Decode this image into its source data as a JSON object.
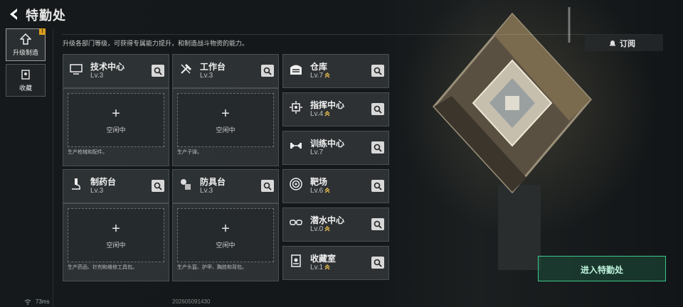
{
  "header": {
    "title": "特勤处",
    "back_label": ""
  },
  "subtitle": "升级各部门等级，可获得专属能力提升，和制造战斗物资的能力。",
  "tabs": [
    {
      "label": "升级制造",
      "badge": "!"
    },
    {
      "label": "收藏"
    }
  ],
  "subscribe_label": "订阅",
  "enter_label": "进入特勤处",
  "large_cards": [
    {
      "name": "技术中心",
      "level": "Lv.3",
      "slot_status": "空闲中",
      "slot_plus": "+",
      "desc": "生产枪械和配件。",
      "icon": "monitor-icon"
    },
    {
      "name": "工作台",
      "level": "Lv.3",
      "slot_status": "空闲中",
      "slot_plus": "+",
      "desc": "生产子弹。",
      "icon": "hammer-icon"
    },
    {
      "name": "制药台",
      "level": "Lv.3",
      "slot_status": "空闲中",
      "slot_plus": "+",
      "desc": "生产药品、针剂和维修工具包。",
      "icon": "microscope-icon"
    },
    {
      "name": "防具台",
      "level": "Lv.3",
      "slot_status": "空闲中",
      "slot_plus": "+",
      "desc": "生产头盔、护甲、胸挂和背包。",
      "icon": "armor-icon"
    }
  ],
  "small_cards": [
    {
      "name": "仓库",
      "level": "Lv.7",
      "upgrade": true,
      "icon": "warehouse-icon"
    },
    {
      "name": "指挥中心",
      "level": "Lv.4",
      "upgrade": true,
      "icon": "chip-icon"
    },
    {
      "name": "训练中心",
      "level": "Lv.7",
      "upgrade": false,
      "icon": "dumbbell-icon"
    },
    {
      "name": "靶场",
      "level": "Lv.6",
      "upgrade": true,
      "icon": "target-icon"
    },
    {
      "name": "潜水中心",
      "level": "Lv.0",
      "upgrade": true,
      "icon": "goggles-icon"
    },
    {
      "name": "收藏室",
      "level": "Lv.1",
      "upgrade": true,
      "icon": "display-case-icon"
    }
  ],
  "status": {
    "ping": "73ms",
    "build": "202605091430"
  },
  "colors": {
    "accent_green": "#3ec88a",
    "upgrade_gold": "#d9b24a",
    "badge_yellow": "#d9a020"
  }
}
